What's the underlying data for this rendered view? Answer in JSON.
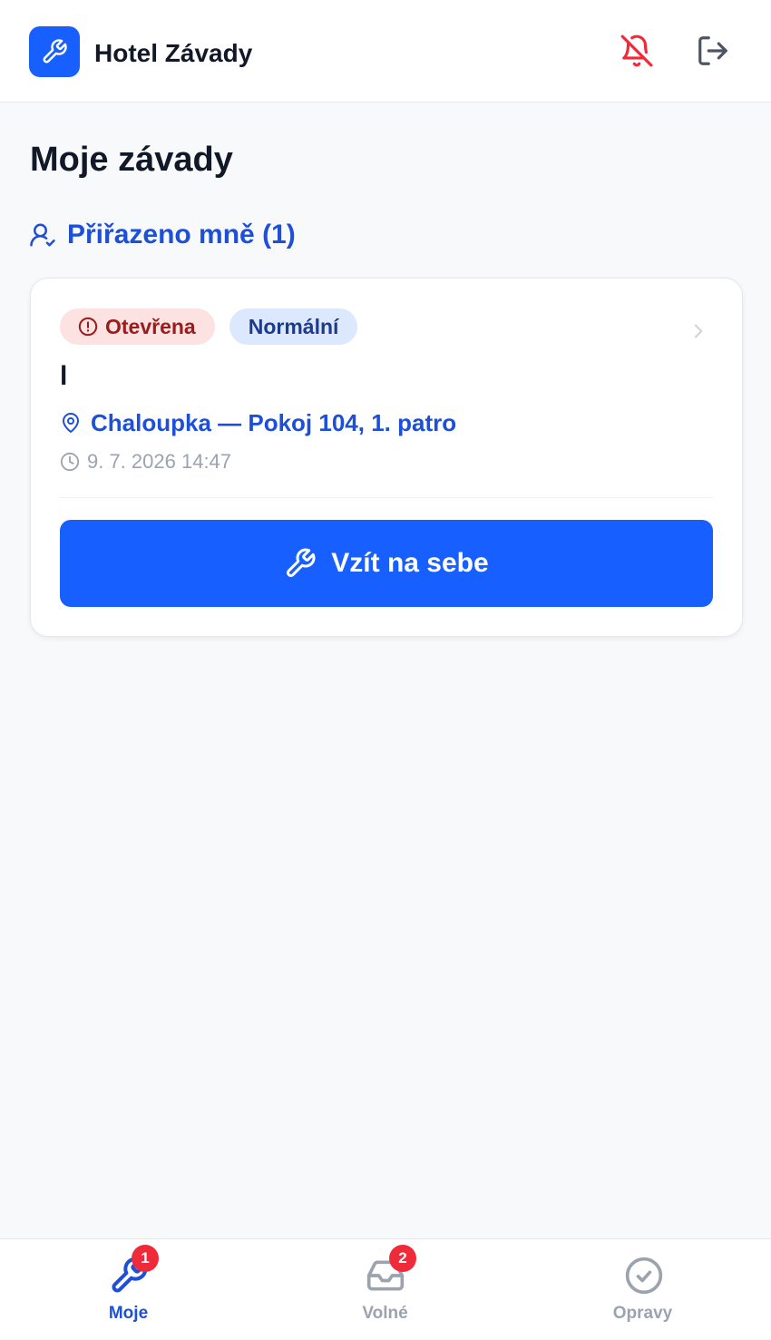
{
  "header": {
    "app_title": "Hotel Závady",
    "logo_icon": "wrench-icon",
    "notifications_icon": "bell-off-icon",
    "logout_icon": "logout-icon"
  },
  "page": {
    "title": "Moje závady"
  },
  "section": {
    "icon": "user-check-icon",
    "label": "Přiřazeno mně (1)"
  },
  "issue": {
    "status_label": "Otevřena",
    "priority_label": "Normální",
    "title": "l",
    "location": "Chaloupka — Pokoj 104, 1. patro",
    "timestamp": "9. 7. 2026 14:47",
    "action_label": "Vzít na sebe"
  },
  "bottom_nav": {
    "items": [
      {
        "label": "Moje",
        "icon": "wrench-icon",
        "badge": "1",
        "active": true
      },
      {
        "label": "Volné",
        "icon": "inbox-icon",
        "badge": "2",
        "active": false
      },
      {
        "label": "Opravy",
        "icon": "check-circle-icon",
        "active": false
      }
    ]
  },
  "colors": {
    "primary": "#1760ff",
    "link_blue": "#1d4fd8",
    "danger": "#ef2b3a",
    "status_bg": "#fde2e2",
    "priority_bg": "#dbe8fe",
    "muted": "#9ca3af"
  }
}
